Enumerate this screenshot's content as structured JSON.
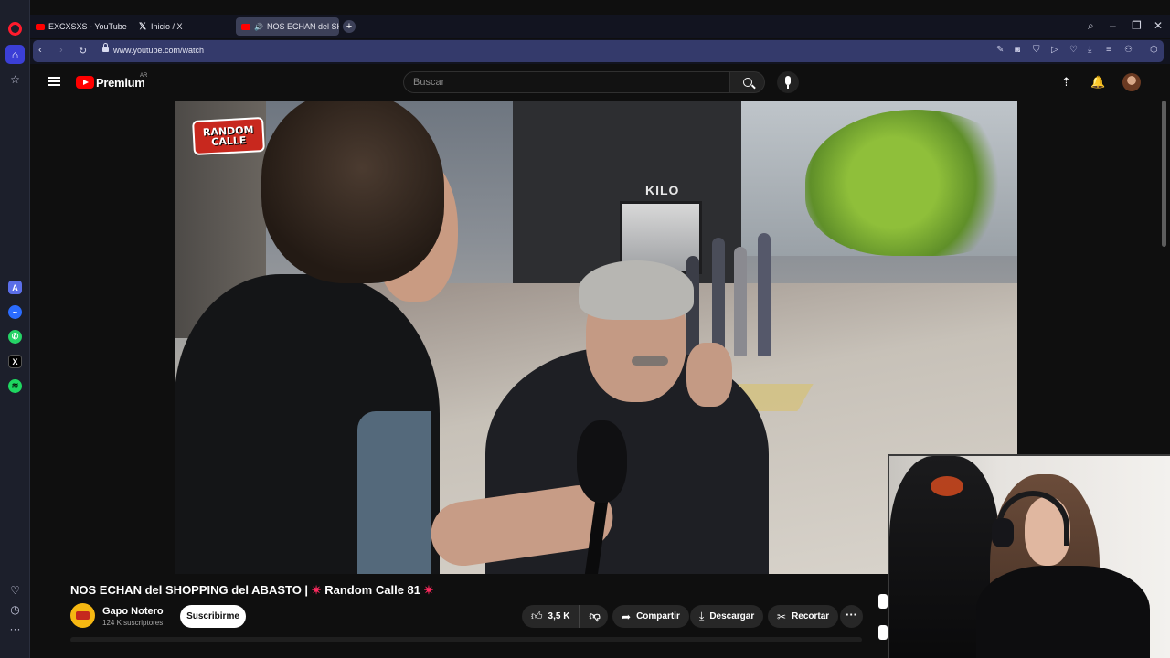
{
  "browser": {
    "tabs": [
      {
        "label": "EXCXSXS - YouTube",
        "type": "youtube"
      },
      {
        "label": "Inicio / X",
        "type": "x"
      },
      {
        "label": "NOS ECHAN del SHO",
        "type": "youtube-audio"
      }
    ],
    "url": "www.youtube.com/watch"
  },
  "youtube": {
    "brand": "Premium",
    "country": "AR",
    "search_placeholder": "Buscar"
  },
  "video": {
    "title_main": "NOS ECHAN del SHOPPING del ABASTO |",
    "title_sparkle": "✴",
    "title_series": "Random Calle 81",
    "overlay_logo_line1": "RANDOM",
    "overlay_logo_line2": "CALLE",
    "sign_text": "KILO"
  },
  "channel": {
    "name": "Gapo Notero",
    "subscribers": "124 K suscriptores",
    "subscribe_label": "Suscribirme"
  },
  "actions": {
    "likes": "3,5 K",
    "share": "Compartir",
    "download": "Descargar",
    "clip": "Recortar",
    "more": "···"
  },
  "colors": {
    "youtube_red": "#ff0000",
    "opera_accent": "#3b3fd6",
    "background": "#0f0f0f"
  }
}
